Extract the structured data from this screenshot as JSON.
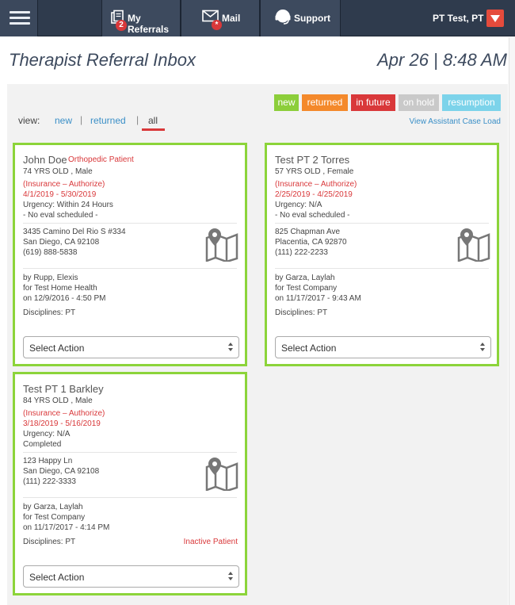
{
  "nav": {
    "menu_icon": "hamburger-icon",
    "tabs": [
      {
        "label": "My Referrals",
        "icon": "referrals-icon",
        "badge": "2"
      },
      {
        "label": "Mail",
        "icon": "mail-icon",
        "badge": "*"
      },
      {
        "label": "Support",
        "icon": "support-icon"
      }
    ],
    "user": "PT Test, PT",
    "user_menu_icon": "caret-down-icon"
  },
  "header": {
    "title": "Therapist Referral Inbox",
    "clock": "Apr 26 | 8:48 AM"
  },
  "legend": {
    "items": [
      {
        "label": "new",
        "color": "#8cce3a"
      },
      {
        "label": "returned",
        "color": "#f4892b"
      },
      {
        "label": "in future",
        "color": "#d9383a"
      },
      {
        "label": "on hold",
        "color": "#c9c9c9"
      },
      {
        "label": "resumption",
        "color": "#7cd3ea"
      }
    ]
  },
  "view": {
    "label": "view:",
    "options": [
      "new",
      "returned",
      "all"
    ],
    "separator": "|",
    "selected": "all",
    "assistant_link": "View Assistant Case Load"
  },
  "cards": [
    {
      "name": "John Doe",
      "tag": "Orthopedic Patient",
      "age_gender": "74 YRS OLD , Male",
      "insurance": "(Insurance – Authorize)",
      "dates": "4/1/2019 - 5/30/2019",
      "urgency": "Urgency: Within 24 Hours",
      "status": "- No eval scheduled -",
      "address1": "3435 Camino Del Rio S #334",
      "address2": "San Diego, CA 92108",
      "phone": "(619) 888-5838",
      "by": "by Rupp, Elexis",
      "for": "for Test Home Health",
      "on": "on 12/9/2016 - 4:50 PM",
      "disciplines": "Disciplines: PT",
      "inactive": "",
      "action": "Select Action",
      "border_color": "#8cd43a"
    },
    {
      "name": "Test PT 2 Torres",
      "tag": "",
      "age_gender": "57 YRS OLD , Female",
      "insurance": "(Insurance – Authorize)",
      "dates": "2/25/2019 - 4/25/2019",
      "urgency": "Urgency: N/A",
      "status": "- No eval scheduled -",
      "address1": "825 Chapman Ave",
      "address2": "Placentia, CA 92870",
      "phone": "(111) 222-2233",
      "by": "by Garza, Laylah",
      "for": "for Test Company",
      "on": "on 11/17/2017 - 9:43 AM",
      "disciplines": "Disciplines: PT",
      "inactive": "",
      "action": "Select Action",
      "border_color": "#8cd43a"
    },
    {
      "name": "Test PT 1 Barkley",
      "tag": "",
      "age_gender": "84 YRS OLD , Male",
      "insurance": "(Insurance – Authorize)",
      "dates": "3/18/2019 - 5/16/2019",
      "urgency": "Urgency: N/A",
      "status": "Completed",
      "address1": "123 Happy Ln",
      "address2": "San Diego, CA 92108",
      "phone": "(111) 222-3333",
      "by": "by Garza, Laylah",
      "for": "for Test Company",
      "on": "on 11/17/2017 - 4:14 PM",
      "disciplines": "Disciplines: PT",
      "inactive": "Inactive Patient",
      "action": "Select Action",
      "border_color": "#8cd43a"
    }
  ]
}
